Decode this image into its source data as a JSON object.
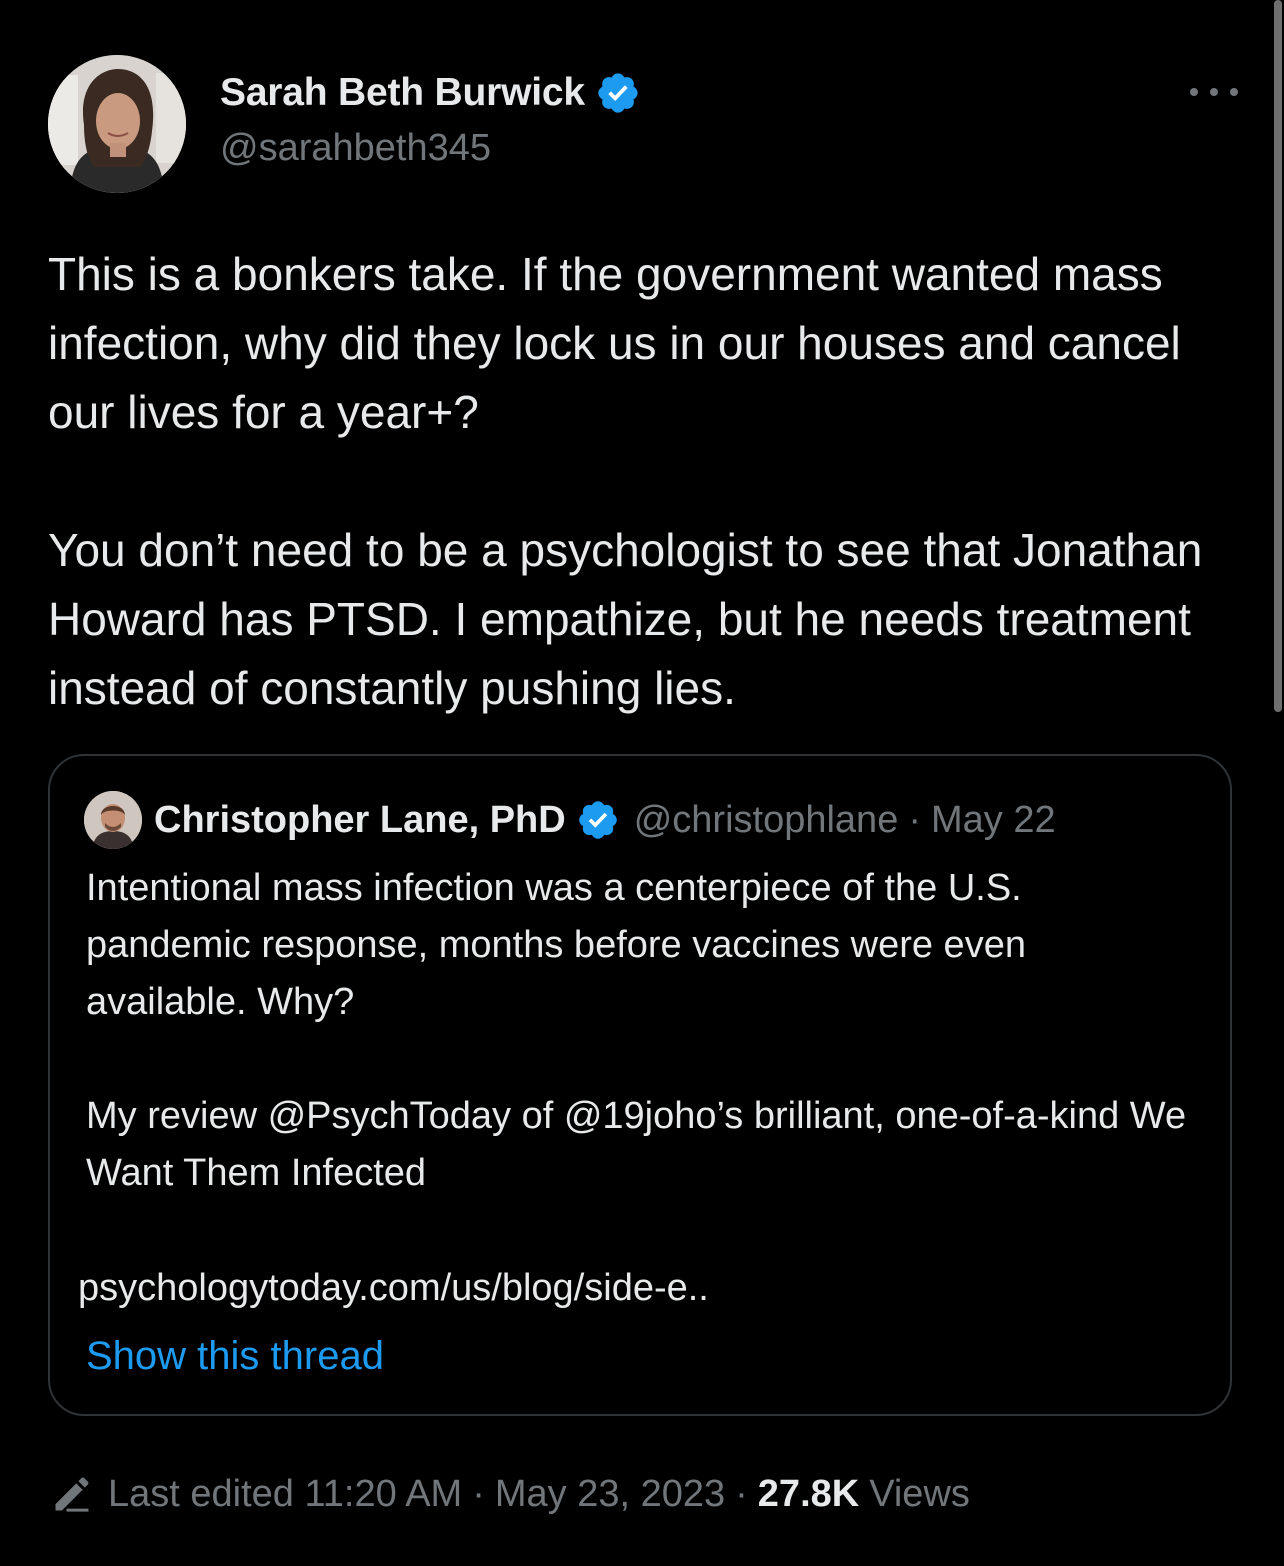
{
  "tweet": {
    "author": {
      "display_name": "Sarah Beth Burwick",
      "handle": "@sarahbeth345",
      "verified_icon": "verified-badge-icon",
      "avatar_icon": "profile-photo"
    },
    "more_icon": "more-options-icon",
    "text_paragraphs": [
      "This is a bonkers take. If the government wanted mass infection, why did they lock us in our houses and cancel our lives for a year+?",
      "You don’t need to be a psychologist to see that Jonathan Howard has PTSD. I empathize, but he needs treatment instead of constantly pushing lies."
    ],
    "quoted": {
      "display_name": "Christopher Lane, PhD",
      "handle": "@christophlane",
      "separator": "·",
      "date": "May 22",
      "text_paragraphs": [
        "Intentional mass infection was a centerpiece of the U.S. pandemic response, months before vaccines were even available. Why?",
        "My review @PsychToday of @19joho’s brilliant, one-of-a-kind We Want Them Infected"
      ],
      "link": "psychologytoday.com/us/blog/side-e..",
      "show_thread": "Show this thread"
    },
    "footer": {
      "edit_icon": "pencil-icon",
      "edited_label": "Last edited 11:20 AM",
      "separator": "·",
      "date": "May 23, 2023",
      "views_count": "27.8K",
      "views_label": "Views"
    }
  },
  "colors": {
    "background": "#000000",
    "text": "#e7e9ea",
    "secondary": "#71767b",
    "link": "#1d9bf0",
    "verified": "#1d9bf0",
    "border": "#2f3336"
  }
}
